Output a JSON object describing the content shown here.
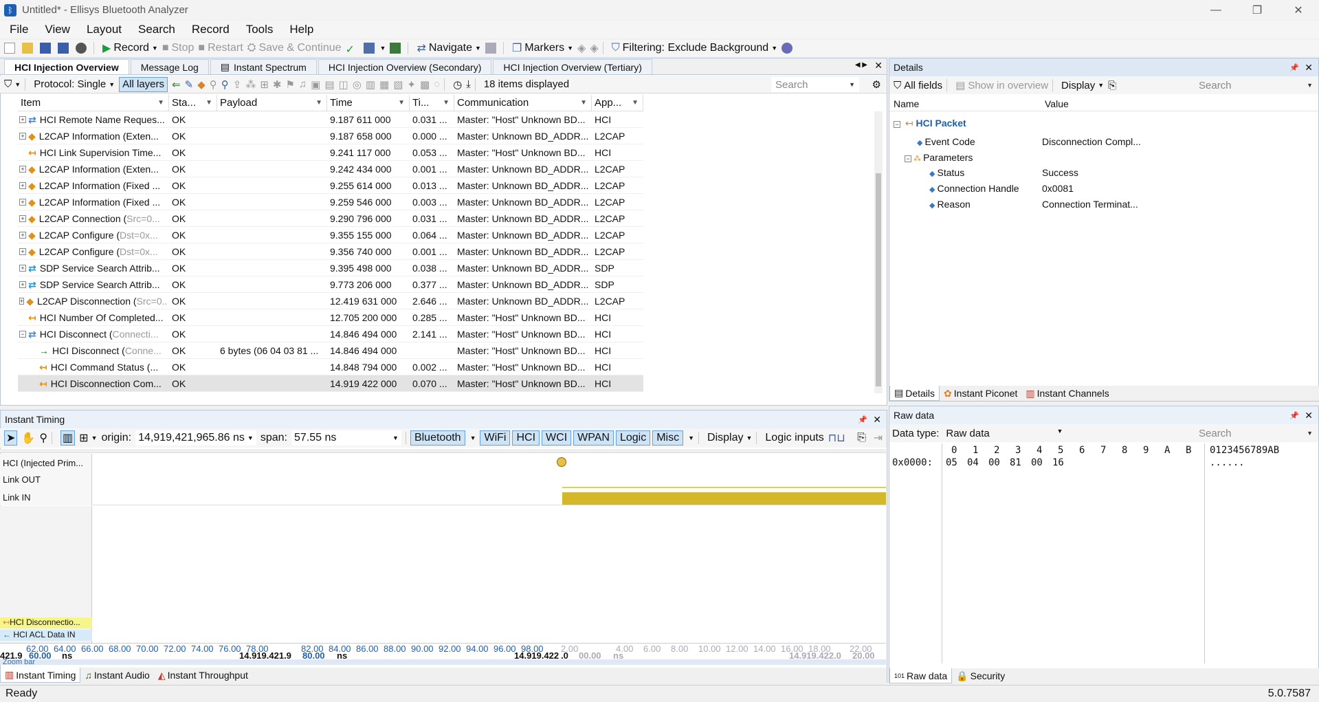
{
  "window": {
    "title": "Untitled* - Ellisys Bluetooth Analyzer",
    "minimize": "—",
    "maximize": "❐",
    "close": "✕"
  },
  "menu": [
    "File",
    "View",
    "Layout",
    "Search",
    "Record",
    "Tools",
    "Help"
  ],
  "toolbar": {
    "record": "Record",
    "stop": "Stop",
    "restart": "Restart",
    "save_continue": "Save & Continue",
    "navigate": "Navigate",
    "markers": "Markers",
    "filtering": "Filtering: Exclude Background"
  },
  "doc_tabs": [
    "HCI Injection Overview",
    "Message Log",
    "Instant Spectrum",
    "HCI Injection Overview (Secondary)",
    "HCI Injection Overview (Tertiary)"
  ],
  "filterbar": {
    "protocol": "Protocol: Single",
    "all_layers": "All layers",
    "items_displayed": "18 items displayed",
    "search_placeholder": "Search"
  },
  "grid": {
    "columns": [
      "Item",
      "Sta...",
      "Payload",
      "Time",
      "Ti...",
      "Communication",
      "App..."
    ],
    "rows": [
      {
        "item": "HCI Remote Name Reques...",
        "status": "OK",
        "payload": "",
        "time": "9.187 611 000",
        "ti": "0.031 ...",
        "comm": "Master: \"Host\" Unknown BD...",
        "app": "HCI",
        "icon": "hci",
        "level": 0,
        "exp": "+"
      },
      {
        "item": "L2CAP Information (Exten...",
        "status": "OK",
        "payload": "",
        "time": "9.187 658 000",
        "ti": "0.000 ...",
        "comm": "Master: Unknown BD_ADDR...",
        "app": "L2CAP",
        "icon": "l2cap",
        "level": 0,
        "exp": "+"
      },
      {
        "item": "HCI Link Supervision Time...",
        "status": "OK",
        "payload": "",
        "time": "9.241 117 000",
        "ti": "0.053 ...",
        "comm": "Master: \"Host\" Unknown BD...",
        "app": "HCI",
        "icon": "evt",
        "level": 0,
        "exp": ""
      },
      {
        "item": "L2CAP Information (Exten...",
        "status": "OK",
        "payload": "",
        "time": "9.242 434 000",
        "ti": "0.001 ...",
        "comm": "Master: Unknown BD_ADDR...",
        "app": "L2CAP",
        "icon": "l2cap",
        "level": 0,
        "exp": "+"
      },
      {
        "item": "L2CAP Information (Fixed ...",
        "status": "OK",
        "payload": "",
        "time": "9.255 614 000",
        "ti": "0.013 ...",
        "comm": "Master: Unknown BD_ADDR...",
        "app": "L2CAP",
        "icon": "l2cap",
        "level": 0,
        "exp": "+"
      },
      {
        "item": "L2CAP Information (Fixed ...",
        "status": "OK",
        "payload": "",
        "time": "9.259 546 000",
        "ti": "0.003 ...",
        "comm": "Master: Unknown BD_ADDR...",
        "app": "L2CAP",
        "icon": "l2cap",
        "level": 0,
        "exp": "+"
      },
      {
        "item": "L2CAP Connection (",
        "item_dim": "Src=0...",
        "status": "OK",
        "payload": "",
        "time": "9.290 796 000",
        "ti": "0.031 ...",
        "comm": "Master: Unknown BD_ADDR...",
        "app": "L2CAP",
        "icon": "l2cap",
        "level": 0,
        "exp": "+"
      },
      {
        "item": "L2CAP Configure (",
        "item_dim": "Dst=0x...",
        "status": "OK",
        "payload": "",
        "time": "9.355 155 000",
        "ti": "0.064 ...",
        "comm": "Master: Unknown BD_ADDR...",
        "app": "L2CAP",
        "icon": "l2cap",
        "level": 0,
        "exp": "+"
      },
      {
        "item": "L2CAP Configure (",
        "item_dim": "Dst=0x...",
        "status": "OK",
        "payload": "",
        "time": "9.356 740 000",
        "ti": "0.001 ...",
        "comm": "Master: Unknown BD_ADDR...",
        "app": "L2CAP",
        "icon": "l2cap",
        "level": 0,
        "exp": "+"
      },
      {
        "item": "SDP Service Search Attrib...",
        "status": "OK",
        "payload": "",
        "time": "9.395 498 000",
        "ti": "0.038 ...",
        "comm": "Master: Unknown BD_ADDR...",
        "app": "SDP",
        "icon": "sdp",
        "level": 0,
        "exp": "+"
      },
      {
        "item": "SDP Service Search Attrib...",
        "status": "OK",
        "payload": "",
        "time": "9.773 206 000",
        "ti": "0.377 ...",
        "comm": "Master: Unknown BD_ADDR...",
        "app": "SDP",
        "icon": "sdp",
        "level": 0,
        "exp": "+"
      },
      {
        "item": "L2CAP Disconnection (",
        "item_dim": "Src=0...",
        "status": "OK",
        "payload": "",
        "time": "12.419 631 000",
        "ti": "2.646 ...",
        "comm": "Master: Unknown BD_ADDR...",
        "app": "L2CAP",
        "icon": "l2cap",
        "level": 0,
        "exp": "+"
      },
      {
        "item": "HCI Number Of Completed...",
        "status": "OK",
        "payload": "",
        "time": "12.705 200 000",
        "ti": "0.285 ...",
        "comm": "Master: \"Host\" Unknown BD...",
        "app": "HCI",
        "icon": "evt",
        "level": 0,
        "exp": ""
      },
      {
        "item": "HCI Disconnect (",
        "item_dim": "Connecti...",
        "status": "OK",
        "payload": "",
        "time": "14.846 494 000",
        "ti": "2.141 ...",
        "comm": "Master: \"Host\" Unknown BD...",
        "app": "HCI",
        "icon": "hci",
        "level": 0,
        "exp": "−"
      },
      {
        "item": "HCI Disconnect (",
        "item_dim": "Conne...",
        "status": "OK",
        "payload": "6 bytes (06 04 03 81 ...",
        "time": "14.846 494 000",
        "ti": "",
        "comm": "Master: \"Host\" Unknown BD...",
        "app": "HCI",
        "icon": "cmd",
        "level": 1,
        "exp": ""
      },
      {
        "item": "HCI Command Status (...",
        "status": "OK",
        "payload": "",
        "time": "14.848 794 000",
        "ti": "0.002 ...",
        "comm": "Master: \"Host\" Unknown BD...",
        "app": "HCI",
        "icon": "evt",
        "level": 1,
        "exp": ""
      },
      {
        "item": "HCI Disconnection Com...",
        "status": "OK",
        "payload": "",
        "time": "14.919 422 000",
        "ti": "0.070 ...",
        "comm": "Master: \"Host\" Unknown BD...",
        "app": "HCI",
        "icon": "evt",
        "level": 1,
        "exp": "",
        "selected": true
      }
    ]
  },
  "details": {
    "title": "Details",
    "all_fields": "All fields",
    "show_in_overview": "Show in overview",
    "display": "Display",
    "search_placeholder": "Search",
    "col_name": "Name",
    "col_value": "Value",
    "packet": "HCI Packet",
    "fields": [
      {
        "name": "Event Code",
        "value": "Disconnection Compl..."
      },
      {
        "name": "Parameters",
        "value": ""
      },
      {
        "name": "Status",
        "value": "Success"
      },
      {
        "name": "Connection Handle",
        "value": "0x0081"
      },
      {
        "name": "Reason",
        "value": "Connection Terminat..."
      }
    ],
    "tabs": [
      "Details",
      "Instant Piconet",
      "Instant Channels"
    ]
  },
  "timing": {
    "title": "Instant Timing",
    "origin_label": "origin:",
    "origin": "14,919,421,965.86 ns",
    "span_label": "span:",
    "span": "57.55 ns",
    "chips": [
      "Bluetooth",
      "WiFi",
      "HCI",
      "WCI",
      "WPAN",
      "Logic",
      "Misc"
    ],
    "display": "Display",
    "logic_inputs": "Logic inputs",
    "lanes": [
      "HCI (Injected Prim...",
      "Link OUT",
      "Link IN"
    ],
    "bottom_labels": [
      "HCI Disconnectio...",
      "HCI ACL Data IN"
    ],
    "ruler_top": [
      "62.00",
      "64.00",
      "66.00",
      "68.00",
      "70.00",
      "72.00",
      "74.00",
      "76.00",
      "78.00",
      "82.00",
      "84.00",
      "86.00",
      "88.00",
      "90.00",
      "92.00",
      "94.00",
      "96.00",
      "98.00",
      "2.00",
      "4.00",
      "6.00",
      "8.00",
      "10.00",
      "12.00",
      "14.00",
      "16.00",
      "18.00",
      "22.00"
    ],
    "ruler_bottom": [
      "421.9",
      "60.00",
      "ns",
      "14.919.421.9",
      "80.00",
      "ns",
      "14.919.422",
      ".0",
      "00.00",
      "ns",
      "14.919.422.0",
      "20.00"
    ],
    "zoom_bar": "Zoom bar",
    "tabs": [
      "Instant Timing",
      "Instant Audio",
      "Instant Throughput"
    ]
  },
  "rawdata": {
    "title": "Raw data",
    "data_type_label": "Data type:",
    "data_type": "Raw data",
    "search_placeholder": "Search",
    "hex_header": [
      "0",
      "1",
      "2",
      "3",
      "4",
      "5",
      "6",
      "7",
      "8",
      "9",
      "A",
      "B"
    ],
    "ascii_header": "0123456789AB",
    "offset": "0x0000:",
    "bytes": [
      "05",
      "04",
      "00",
      "81",
      "00",
      "16"
    ],
    "ascii": "......",
    "tabs": [
      "Raw data",
      "Security"
    ]
  },
  "status": {
    "text": "Ready",
    "version": "5.0.7587"
  },
  "colors": {
    "accent": "#1b5fb4",
    "selection": "#cde4f7",
    "link_in": "#d4b82a",
    "panel_head": "#dde8f4"
  }
}
